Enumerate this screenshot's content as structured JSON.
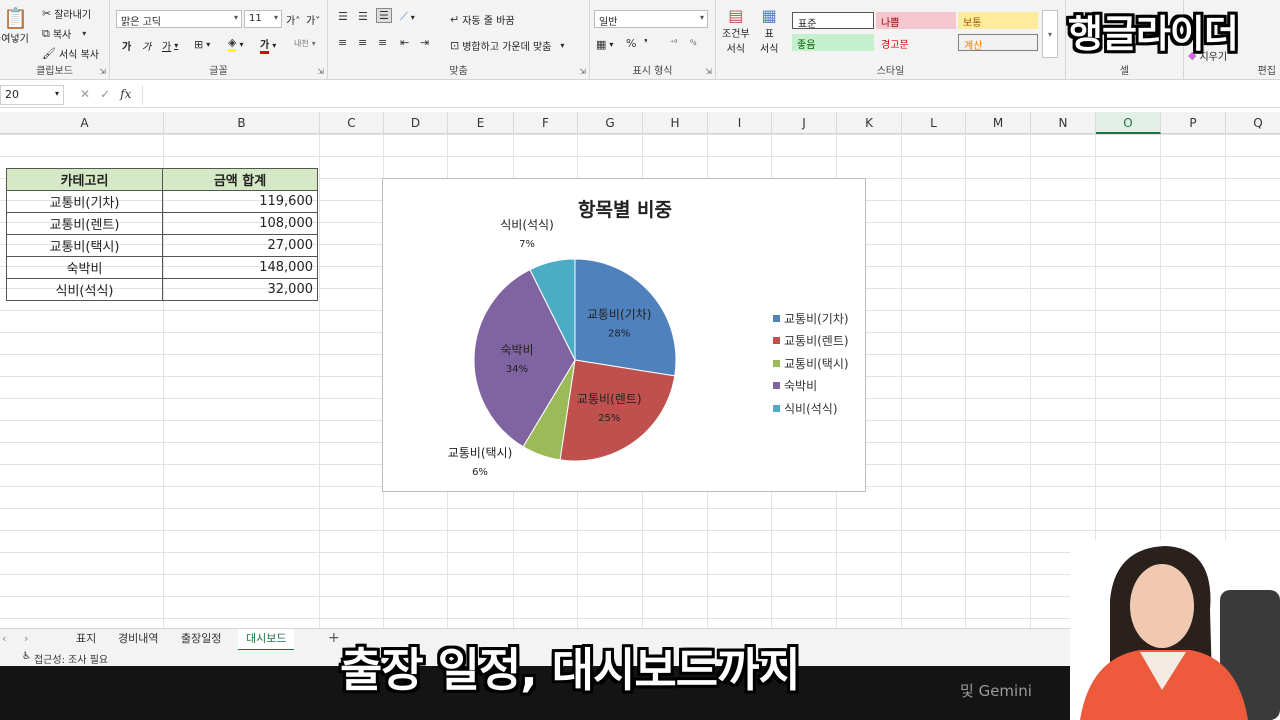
{
  "ribbon": {
    "clipboard": {
      "paste": "붙여넣기",
      "cut": "잘라내기",
      "copy": "복사",
      "format_painter": "서식 복사",
      "label": "클립보드"
    },
    "font": {
      "font_name": "맑은 고딕",
      "font_size": "11",
      "grow": "가˄",
      "shrink": "가˅",
      "bold": "가",
      "italic": "가",
      "underline": "가",
      "font_color_glyph": "가",
      "phonetic": "내천",
      "label": "글꼴"
    },
    "alignment": {
      "wrap_text": "자동 줄 바꿈",
      "merge_center": "병합하고 가운데 맞춤",
      "label": "맞춤"
    },
    "number": {
      "format": "일반",
      "label": "표시 형식"
    },
    "styles": {
      "conditional": "조건부",
      "conditional_sub": "서식",
      "table_format": "표",
      "table_format_sub": "서식",
      "cells": [
        "표준",
        "나쁨",
        "보통",
        "좋음",
        "경고문",
        "계산"
      ],
      "label": "스타일"
    },
    "cells_label": "셀",
    "edit_label": "편집",
    "edit_partial": "지우기"
  },
  "formula_bar": {
    "name_box": "20",
    "fx": "fx",
    "value": ""
  },
  "grid": {
    "columns": [
      "A",
      "B",
      "C",
      "D",
      "E",
      "F",
      "G",
      "H",
      "I",
      "J",
      "K",
      "L",
      "M",
      "N",
      "O",
      "P",
      "Q"
    ],
    "table": {
      "headers": [
        "카테고리",
        "금액 합계"
      ],
      "rows": [
        {
          "category": "교통비(기차)",
          "amount": "119,600"
        },
        {
          "category": "교통비(렌트)",
          "amount": "108,000"
        },
        {
          "category": "교통비(택시)",
          "amount": "27,000"
        },
        {
          "category": "숙박비",
          "amount": "148,000"
        },
        {
          "category": "식비(석식)",
          "amount": "32,000"
        }
      ]
    }
  },
  "chart_data": {
    "type": "pie",
    "title": "항목별 비중",
    "categories": [
      "교통비(기차)",
      "교통비(렌트)",
      "교통비(택시)",
      "숙박비",
      "식비(석식)"
    ],
    "values": [
      119600,
      108000,
      27000,
      148000,
      32000
    ],
    "data_labels": [
      "28%",
      "25%",
      "6%",
      "34%",
      "7%"
    ],
    "colors": [
      "#4f81bd",
      "#c0504d",
      "#9bbb59",
      "#8064a2",
      "#4bacc6"
    ],
    "legend": "right"
  },
  "sheet_tabs": {
    "tabs": [
      "표지",
      "경비내역",
      "출장일정",
      "대시보드"
    ],
    "active": "대시보드",
    "add": "+"
  },
  "status_bar": {
    "accessibility": "접근성: 조사 필요"
  },
  "overlay": {
    "caption": "출장 일정, 대시보드까지",
    "watermark": "행글라이더",
    "ghost_caption": "및 Gemini"
  }
}
